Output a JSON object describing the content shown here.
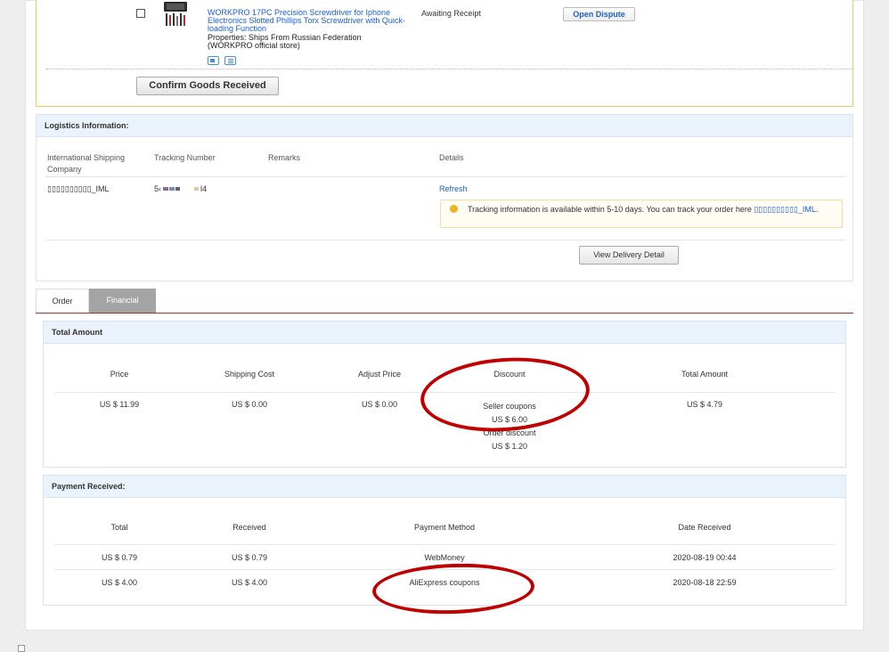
{
  "order_item": {
    "product_title": "WORKPRO 17PC Precision Screwdriver for Iphone Electronics Slotted Phillips Torx Screwdriver with Quick-loading Function",
    "properties_line1": "Properties: Ships From Russian Federation",
    "properties_line2": "(WORKPRO official store)",
    "status": "Awaiting Receipt",
    "open_dispute_label": "Open Dispute",
    "confirm_label": "Confirm Goods Received"
  },
  "logistics": {
    "title": "Logistics Information:",
    "col_company_1": "International Shipping",
    "col_company_2": "Company",
    "col_tracking": "Tracking Number",
    "col_remarks": "Remarks",
    "col_details": "Details",
    "company_value": "▯▯▯▯▯▯▯▯▯▯_IML",
    "tracking_prefix": "5‹",
    "tracking_suffix": "l4",
    "refresh_label": "Refresh",
    "note_text": "Tracking information is available within 5-10 days. You can track your order here ",
    "note_link": "▯▯▯▯▯▯▯▯▯▯_IML",
    "note_end": ".",
    "view_delivery_label": "View Delivery Detail"
  },
  "tabs": {
    "order": "Order",
    "financial": "Financial"
  },
  "total_amount": {
    "title": "Total Amount",
    "headers": [
      "Price",
      "Shipping Cost",
      "Adjust Price",
      "Discount",
      "Total Amount"
    ],
    "price": "US $ 11.99",
    "shipping": "US $ 0.00",
    "adjust": "US $ 0.00",
    "discount_label_1": "Seller coupons",
    "discount_value_1": "US $ 6.00",
    "discount_label_2": "Order discount",
    "discount_value_2": "US $ 1.20",
    "total": "US $ 4.79"
  },
  "payment": {
    "title": "Payment Received:",
    "headers": [
      "Total",
      "Received",
      "Payment Method",
      "Date Received"
    ],
    "rows": [
      {
        "total": "US $ 0.79",
        "received": "US $ 0.79",
        "method": "WebMoney",
        "date": "2020-08-19 00:44"
      },
      {
        "total": "US $ 4.00",
        "received": "US $ 4.00",
        "method": "AliExpress coupons",
        "date": "2020-08-18 22:59"
      }
    ]
  },
  "colors": {
    "link": "#1a5ed1",
    "annotation_red": "#c00000",
    "panel_header": "#eaf2fb"
  }
}
